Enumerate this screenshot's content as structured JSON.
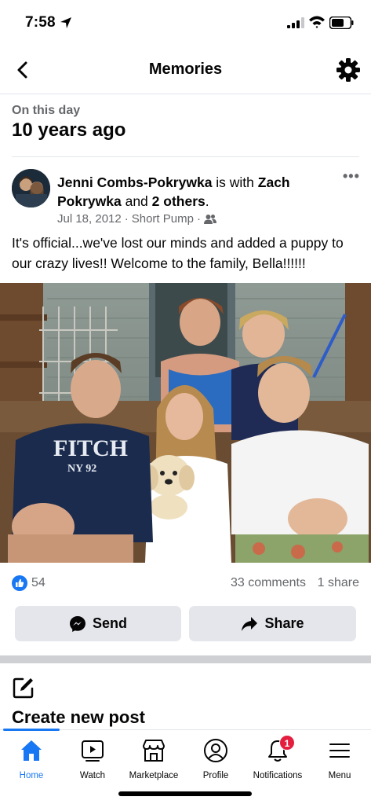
{
  "status_bar": {
    "time": "7:58"
  },
  "nav": {
    "title": "Memories"
  },
  "memory": {
    "label": "On this day",
    "years_ago": "10 years ago"
  },
  "post": {
    "author": "Jenni Combs-Pokrywka",
    "with_text": " is with ",
    "tagged": "Zach Pokrywka",
    "and_text": " and ",
    "others": "2 others",
    "period": ".",
    "date": "Jul 18, 2012",
    "separator": "·",
    "location": "Short Pump",
    "separator2": "·",
    "more": "•••",
    "text": "It's official...we've lost our minds and added a puppy to our crazy lives!!  Welcome to the family, Bella!!!!!!"
  },
  "stats": {
    "likes": "54",
    "comments": "33 comments",
    "shares": "1 share"
  },
  "actions": {
    "send_label": "Send",
    "share_label": "Share"
  },
  "compose": {
    "label": "Create new post"
  },
  "photo": {
    "shirt_text": "FITCH",
    "shirt_sub": "NY 92"
  },
  "tabs": [
    {
      "label": "Home",
      "icon": "home-icon"
    },
    {
      "label": "Watch",
      "icon": "watch-icon"
    },
    {
      "label": "Marketplace",
      "icon": "marketplace-icon"
    },
    {
      "label": "Profile",
      "icon": "profile-icon"
    },
    {
      "label": "Notifications",
      "icon": "bell-icon",
      "badge": "1"
    },
    {
      "label": "Menu",
      "icon": "menu-icon"
    }
  ],
  "colors": {
    "accent": "#1877f2",
    "badge": "#e41e3f",
    "muted": "#65676b",
    "button_bg": "#e4e6eb"
  }
}
